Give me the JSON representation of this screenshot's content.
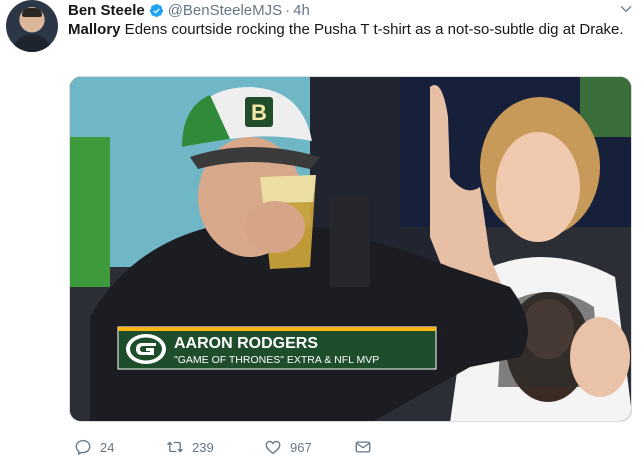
{
  "author": {
    "name": "Ben Steele",
    "handle": "@BenSteeleMJS",
    "time": "4h",
    "separator": "·"
  },
  "tweet": {
    "lead": "Mallory",
    "body": " Edens courtside rocking the Pusha T t-shirt as a not-so-subtle dig at Drake."
  },
  "media": {
    "lower_third_name": "AARON RODGERS",
    "lower_third_sub": "\"GAME OF THRONES\" EXTRA & NFL MVP",
    "cap_letter": "B",
    "colors": {
      "packers_green": "#1e4d2b",
      "packers_gold": "#ffb612"
    }
  },
  "actions": {
    "reply_count": "24",
    "retweet_count": "239",
    "like_count": "967"
  },
  "icons": [
    "verified-icon",
    "caret-down-icon",
    "reply-icon",
    "retweet-icon",
    "like-icon",
    "direct-message-icon",
    "packers-logo-icon"
  ]
}
